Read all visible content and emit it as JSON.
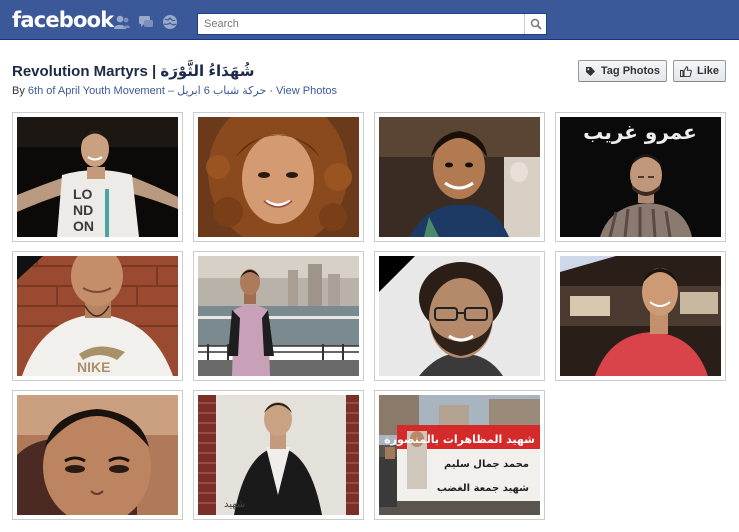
{
  "topbar": {
    "logo": "facebook",
    "search_placeholder": "Search",
    "icons": [
      "friend-requests-icon",
      "messages-icon",
      "notifications-icon",
      "search-icon"
    ]
  },
  "album": {
    "title": "Revolution Martyrs | شُهَدَاءُ الثَّوْرَة",
    "by_prefix": "By",
    "owner": "6th of April Youth Movement – حركة شباب 6 ابريل",
    "separator": "·",
    "view_photos": "View Photos"
  },
  "actions": {
    "tag_photos": "Tag Photos",
    "like": "Like"
  },
  "photos": {
    "p4": {
      "caption": "عمرو غريب"
    },
    "p9": {
      "line1": "شهيد المظاهرات بالمنصورة",
      "line2": "محمد جمال سليم",
      "line3": "شهيد جمعة الغضب"
    }
  },
  "colors": {
    "brand_blue": "#3b5998",
    "link_blue": "#3b5998",
    "title_navy": "#1c2a47"
  }
}
